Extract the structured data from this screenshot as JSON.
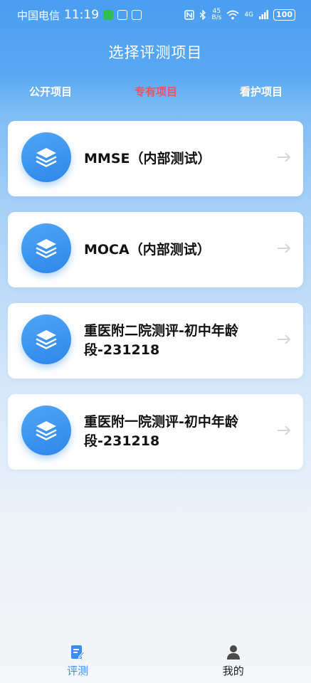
{
  "status_bar": {
    "carrier": "中国电信",
    "time": "11:19",
    "network": "4G",
    "battery": "100"
  },
  "header": {
    "title": "选择评测项目"
  },
  "tabs": [
    {
      "label": "公开项目",
      "active": false
    },
    {
      "label": "专有项目",
      "active": true
    },
    {
      "label": "看护项目",
      "active": false
    }
  ],
  "projects": [
    {
      "name": "MMSE（内部测试）"
    },
    {
      "name": "MOCA（内部测试）"
    },
    {
      "name": "重医附二院测评-初中年龄段-231218"
    },
    {
      "name": "重医附一院测评-初中年龄段-231218"
    }
  ],
  "bottom_nav": [
    {
      "label": "评测",
      "icon": "assessment-icon",
      "active": true
    },
    {
      "label": "我的",
      "icon": "user-icon",
      "active": false
    }
  ],
  "colors": {
    "accent": "#3b8ef0",
    "active_tab": "#f0525c"
  }
}
